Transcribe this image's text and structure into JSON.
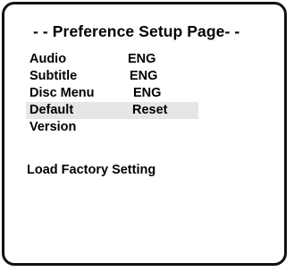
{
  "title": "- - Preference Setup Page- -",
  "menu": {
    "items": [
      {
        "label": "Audio",
        "value": "ENG"
      },
      {
        "label": "Subtitle",
        "value": "ENG"
      },
      {
        "label": "Disc Menu",
        "value": "ENG"
      },
      {
        "label": "Default",
        "value": "Reset"
      },
      {
        "label": "Version",
        "value": ""
      }
    ],
    "selected_label": "Default"
  },
  "hint": "Load Factory Setting",
  "colors": {
    "border": "#111111",
    "highlight": "#e6e6e6",
    "text": "#000000",
    "background": "#ffffff"
  }
}
